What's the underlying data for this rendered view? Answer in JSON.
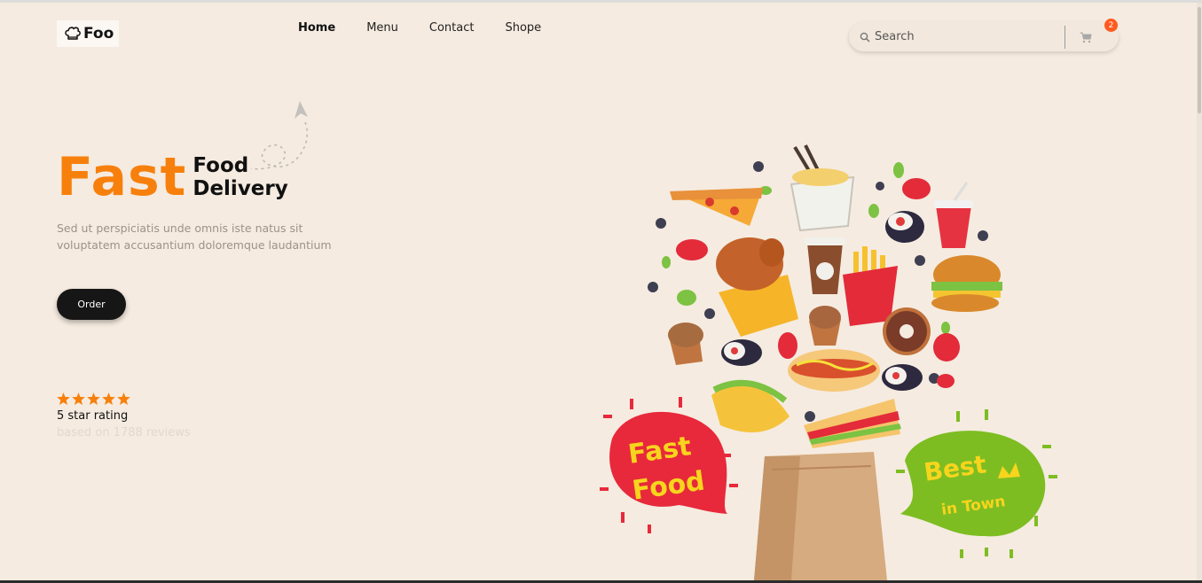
{
  "logo": {
    "text": "Foo",
    "icon": "chef-hat-icon"
  },
  "nav": [
    {
      "label": "Home",
      "active": true
    },
    {
      "label": "Menu",
      "active": false
    },
    {
      "label": "Contact",
      "active": false
    },
    {
      "label": "Shope",
      "active": false
    }
  ],
  "search": {
    "placeholder": "Search",
    "icon": "search-icon"
  },
  "cart": {
    "icon": "cart-icon",
    "count": "2"
  },
  "hero": {
    "title_big": "Fast",
    "title_line1": "Food",
    "title_line2": "Delivery",
    "description": "Sed ut perspiciatis unde omnis iste natus sit voluptatem accusantium doloremque laudantium",
    "order_label": "Order"
  },
  "rating": {
    "stars": 5,
    "label": "5 star rating",
    "sub": "based on 1788 reviews"
  },
  "illustration": {
    "left_bubble_lines": [
      "Fast",
      "Food"
    ],
    "right_bubble_lines": [
      "Best",
      "in Town"
    ]
  },
  "colors": {
    "accent": "#f7800d",
    "background": "#f5ebe0",
    "badge": "#ff5a1f",
    "button": "#161616"
  }
}
